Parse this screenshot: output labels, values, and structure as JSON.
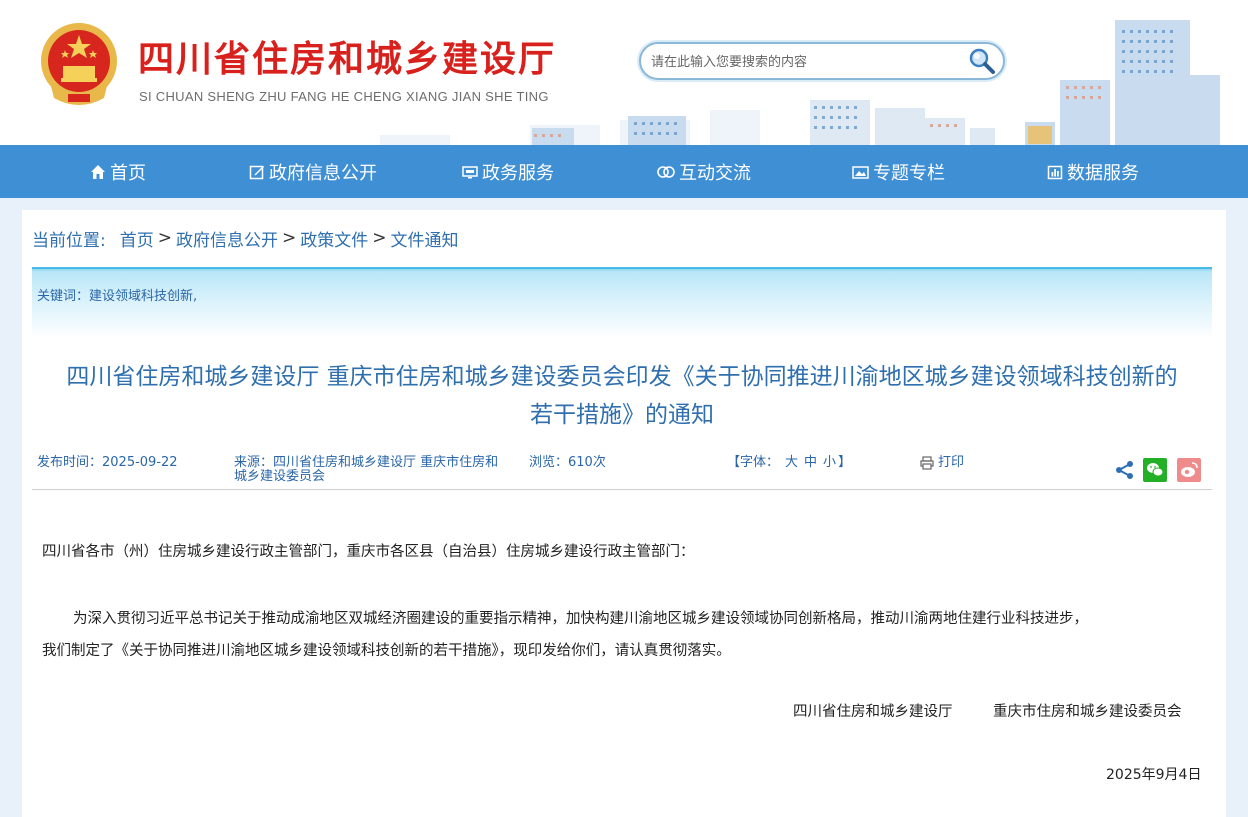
{
  "header": {
    "site_title": "四川省住房和城乡建设厅",
    "site_subtitle": "SI CHUAN SHENG ZHU FANG HE CHENG XIANG JIAN SHE TING",
    "search_placeholder": "请在此输入您要搜索的内容"
  },
  "nav": {
    "items": [
      {
        "label": "首页",
        "icon": "home-icon"
      },
      {
        "label": "政府信息公开",
        "icon": "edit-icon"
      },
      {
        "label": "政务服务",
        "icon": "monitor-icon"
      },
      {
        "label": "互动交流",
        "icon": "exchange-icon"
      },
      {
        "label": "专题专栏",
        "icon": "image-icon"
      },
      {
        "label": "数据服务",
        "icon": "chart-icon"
      }
    ]
  },
  "breadcrumb": {
    "label": "当前位置:",
    "items": [
      "首页",
      "政府信息公开",
      "政策文件",
      "文件通知"
    ],
    "separator": ">"
  },
  "article": {
    "keywords": "关键词：建设领域科技创新,",
    "title_line1": "四川省住房和城乡建设厅 重庆市住房和城乡建设委员会印发《关于协同推进川渝地区城乡建设领域科技创新的",
    "title_line2": "若干措施》的通知",
    "publish_time": "发布时间：2025-09-22",
    "source_line1": "来源：四川省住房和城乡建设厅 重庆市住房和",
    "source_line2": "城乡建设委员会",
    "views": "浏览：610次",
    "font_label": "【字体：",
    "font_large": "大",
    "font_medium": "中",
    "font_small": "小",
    "font_close": "】",
    "print": "打印",
    "salutation": "四川省各市（州）住房城乡建设行政主管部门，重庆市各区县（自治县）住房城乡建设行政主管部门：",
    "para1_line1": "为深入贯彻习近平总书记关于推动成渝地区双城经济圈建设的重要指示精神，加快构建川渝地区城乡建设领域协同创新格局，推动川渝两地住建行业科技进步，",
    "para1_line2": "我们制定了《关于协同推进川渝地区城乡建设领域科技创新的若干措施》，现印发给你们，请认真贯彻落实。",
    "signer1": "四川省住房和城乡建设厅",
    "signer2": "重庆市住房和城乡建设委员会",
    "date": "2025年9月4日"
  },
  "colors": {
    "brand_red": "#d8201c",
    "nav_blue": "#3f8fd4",
    "link_blue": "#2f6fae",
    "wechat_green": "#23b026",
    "weibo_pink": "#f08b8b"
  }
}
